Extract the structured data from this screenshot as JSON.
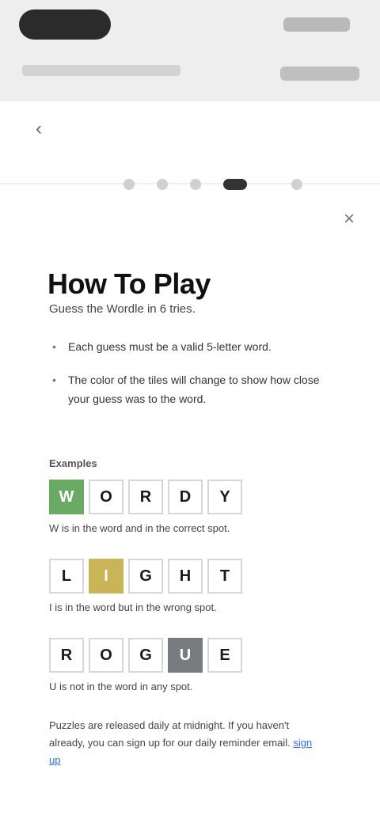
{
  "header": {
    "brand": "",
    "top_right": "",
    "subnav_left": "",
    "subnav_right": ""
  },
  "icons": {
    "back": "arrow-left-icon",
    "close": "close-icon"
  },
  "modal": {
    "title": "How To Play",
    "subtitle": "Guess the Wordle in 6 tries.",
    "bullets": [
      "Each guess must be a valid 5-letter word.",
      "The color of the tiles will change to show how close your guess was to the word."
    ],
    "examples_label": "Examples",
    "examples": [
      {
        "tiles": [
          "w",
          "o",
          "r",
          "d",
          "y"
        ],
        "state": [
          "correct",
          "empty",
          "empty",
          "empty",
          "empty"
        ],
        "text": "W is in the word and in the correct spot."
      },
      {
        "tiles": [
          "l",
          "i",
          "g",
          "h",
          "t"
        ],
        "state": [
          "empty",
          "present",
          "empty",
          "empty",
          "empty"
        ],
        "text": "I is in the word but in the wrong spot."
      },
      {
        "tiles": [
          "r",
          "o",
          "g",
          "u",
          "e"
        ],
        "state": [
          "empty",
          "empty",
          "empty",
          "absent",
          "empty"
        ],
        "text": "U is not in the word in any spot."
      }
    ],
    "footer_text": "Puzzles are released daily at midnight. If you haven't already, you can sign up for our daily reminder email.",
    "footer_link": "sign up"
  },
  "colors": {
    "correct": "#6aaa64",
    "present": "#c9b458",
    "absent": "#787c7e"
  }
}
